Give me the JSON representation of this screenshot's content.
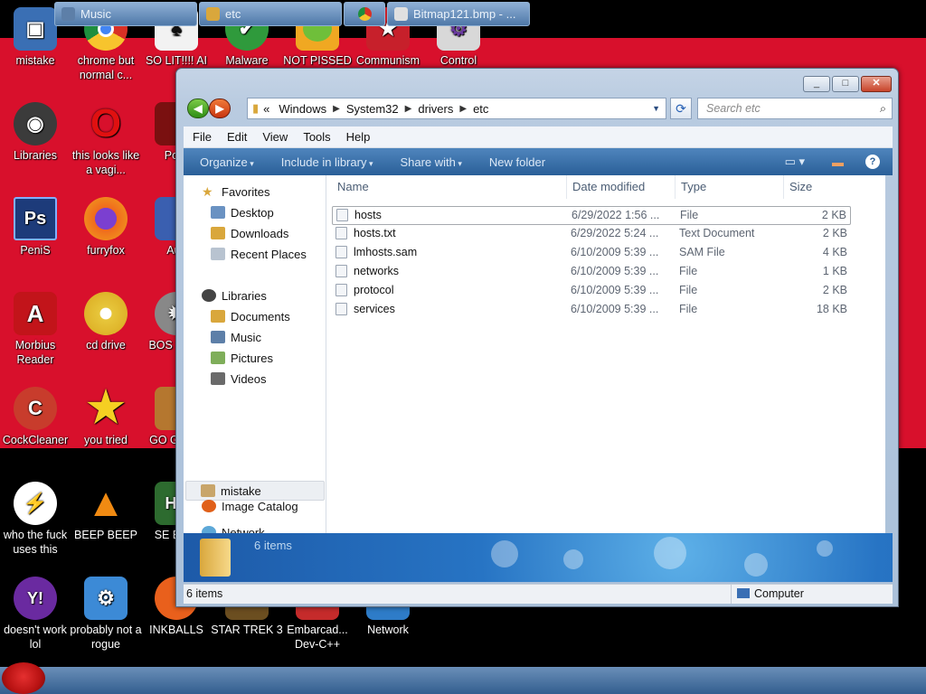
{
  "desktop": {
    "icons": [
      {
        "label": "mistake",
        "color": "#3a6fb4"
      },
      {
        "label": "chrome but normal c...",
        "color": "#e0e0e0"
      },
      {
        "label": "SO LIT!!!! AI",
        "color": "#f2f2f2"
      },
      {
        "label": "Malware",
        "color": "#2f9a3c"
      },
      {
        "label": "NOT PISSED",
        "color": "#f0a822"
      },
      {
        "label": "Communism",
        "color": "#c7202b"
      },
      {
        "label": "Control",
        "color": "#d8d8d8"
      },
      {
        "label": "Libraries",
        "color": "#3b3b3b"
      },
      {
        "label": "this looks like a vagi...",
        "color": "#cc1111"
      },
      {
        "label": "Porn",
        "color": "#7a1010"
      },
      {
        "label": "PeniS",
        "color": "#1d3b7a"
      },
      {
        "label": "furryfox",
        "color": "#e86f1d"
      },
      {
        "label": "Aus",
        "color": "#3a5fb0"
      },
      {
        "label": "Morbius Reader",
        "color": "#c2141a"
      },
      {
        "label": "cd drive",
        "color": "#e7c63b"
      },
      {
        "label": "BOS SIMU",
        "color": "#888888"
      },
      {
        "label": "CockCleaner",
        "color": "#c83c2c"
      },
      {
        "label": "you tried",
        "color": "#f5cf22"
      },
      {
        "label": "GO GADG",
        "color": "#b5772f"
      },
      {
        "label": "who the fuck uses this",
        "color": "#e0601a"
      },
      {
        "label": "BEEP BEEP",
        "color": "#f08a12"
      },
      {
        "label": "SE EDIT",
        "color": "#2d6b2f"
      },
      {
        "label": "doesn't work lol",
        "color": "#6a2aa0"
      },
      {
        "label": "probably not a rogue",
        "color": "#3c8ad6"
      },
      {
        "label": "INKBALLS",
        "color": "#e9601c"
      },
      {
        "label": "STAR TREK 3",
        "color": "#6b4e20"
      },
      {
        "label": "Embarcad... Dev-C++",
        "color": "#c52b2b"
      },
      {
        "label": "Network",
        "color": "#2e7cc8"
      }
    ],
    "icon_glyphs": {
      "ps": "Ps",
      "opera": "O",
      "adobe": "A",
      "yahoo": "Y!",
      "hx": "HX"
    }
  },
  "window": {
    "title_buttons": [
      "_",
      "□",
      "✕"
    ],
    "address": {
      "root": "«",
      "crumbs": [
        "Windows",
        "System32",
        "drivers",
        "etc"
      ]
    },
    "search": {
      "placeholder": "Search etc"
    },
    "menu": [
      "File",
      "Edit",
      "View",
      "Tools",
      "Help"
    ],
    "commands": [
      "Organize",
      "Include in library",
      "Share with",
      "New folder"
    ],
    "nav": {
      "favorites": {
        "header": "Favorites",
        "items": [
          "Desktop",
          "Downloads",
          "Recent Places"
        ]
      },
      "libraries": {
        "header": "Libraries",
        "items": [
          "Documents",
          "Music",
          "Pictures",
          "Videos"
        ]
      },
      "user": "mistake",
      "network": "Network",
      "extra": "Image Catalog"
    },
    "columns": [
      "Name",
      "Date modified",
      "Type",
      "Size"
    ],
    "files": [
      {
        "name": "hosts",
        "date": "6/29/2022 1:56 ...",
        "type": "File",
        "size": "2 KB"
      },
      {
        "name": "hosts.txt",
        "date": "6/29/2022 5:24 ...",
        "type": "Text Document",
        "size": "2 KB"
      },
      {
        "name": "lmhosts.sam",
        "date": "6/10/2009 5:39 ...",
        "type": "SAM File",
        "size": "4 KB"
      },
      {
        "name": "networks",
        "date": "6/10/2009 5:39 ...",
        "type": "File",
        "size": "1 KB"
      },
      {
        "name": "protocol",
        "date": "6/10/2009 5:39 ...",
        "type": "File",
        "size": "2 KB"
      },
      {
        "name": "services",
        "date": "6/10/2009 5:39 ...",
        "type": "File",
        "size": "18 KB"
      }
    ],
    "details": {
      "count": "6 items"
    },
    "status": {
      "left": "6 items",
      "right": "Computer"
    }
  },
  "taskbar": {
    "items": [
      "Music",
      "etc",
      "",
      "Bitmap121.bmp - ..."
    ]
  }
}
